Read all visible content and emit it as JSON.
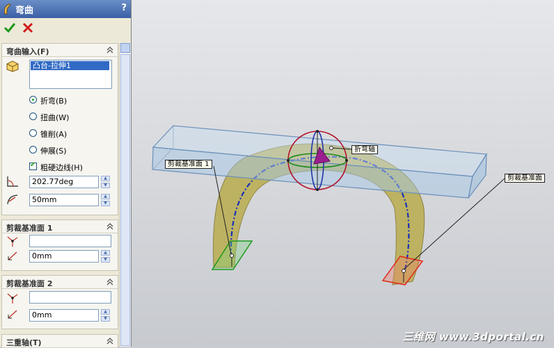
{
  "panel": {
    "title": "弯曲",
    "help": "?",
    "input_group": {
      "title": "弯曲输入(F)",
      "body_list": [
        "凸台-拉伸1"
      ],
      "options": [
        {
          "label": "折弯(B)",
          "selected": true
        },
        {
          "label": "扭曲(W)",
          "selected": false
        },
        {
          "label": "锥削(A)",
          "selected": false
        },
        {
          "label": "伸展(S)",
          "selected": false
        }
      ],
      "rigid_edges_label": "粗硬边线(H)",
      "angle": "202.77deg",
      "radius": "50mm"
    },
    "trim1": {
      "title": "剪裁基准面 1",
      "reference": "",
      "distance": "0mm"
    },
    "trim2": {
      "title": "剪裁基准面 2",
      "reference": "",
      "distance": "0mm"
    },
    "triad": {
      "title": "三重轴(T)"
    }
  },
  "viewport": {
    "callouts": {
      "bend_axis": "折弯轴",
      "trim_plane_1": "剪裁基准面 1",
      "trim_plane_2": "剪裁基准面"
    },
    "watermark": "三维网 www.3dportal.cn",
    "colors": {
      "bent_body": "#bdb262",
      "box": "#a6c8e6",
      "trim1": "#2fa12f",
      "trim2": "#e02b1a",
      "sphere": "#b3122a"
    }
  }
}
